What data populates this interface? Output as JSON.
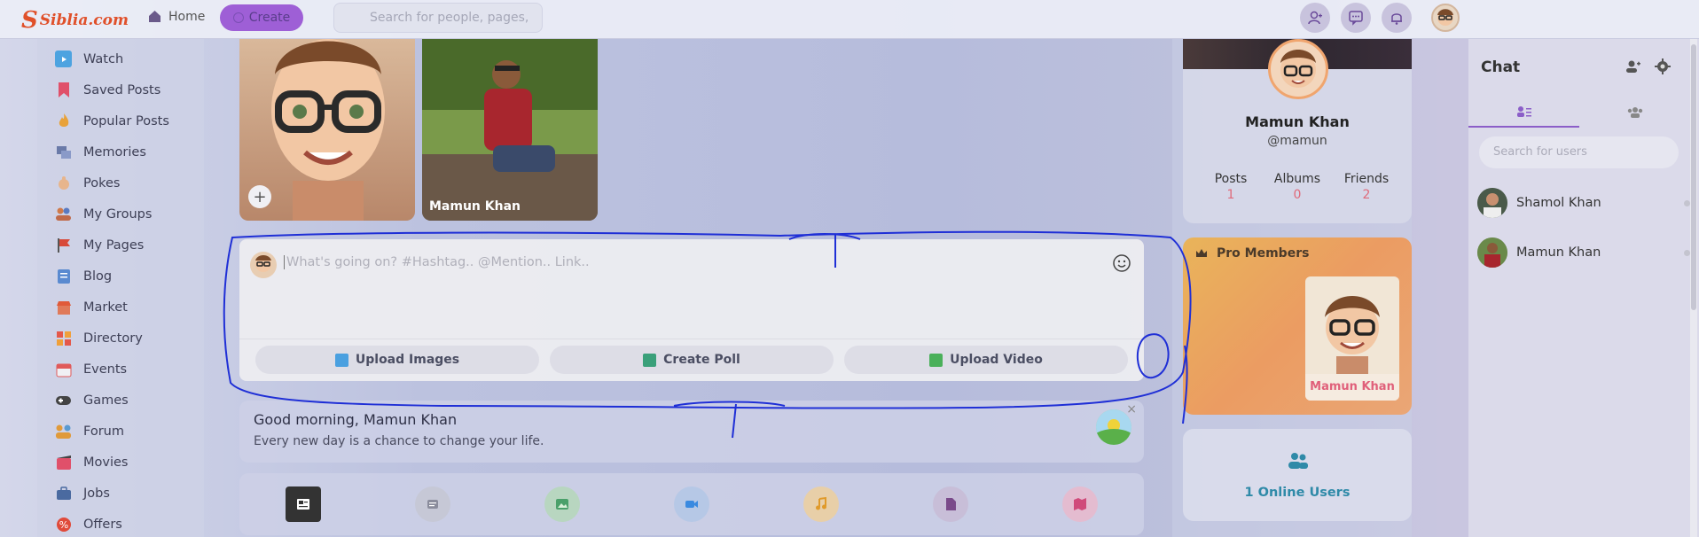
{
  "header": {
    "logo_text": "Siblia.com",
    "home_label": "Home",
    "create_label": "Create",
    "search_placeholder": "Search for people, pages,"
  },
  "sidebar": {
    "items": [
      {
        "label": "Watch",
        "icon": "watch-icon",
        "color": "#4da3e0"
      },
      {
        "label": "Saved Posts",
        "icon": "bookmark-icon",
        "color": "#e0506a"
      },
      {
        "label": "Popular Posts",
        "icon": "fire-icon",
        "color": "#e8a23a"
      },
      {
        "label": "Memories",
        "icon": "memories-icon",
        "color": "#6a7aa8"
      },
      {
        "label": "Pokes",
        "icon": "poke-icon",
        "color": "#e7b58c"
      },
      {
        "label": "My Groups",
        "icon": "groups-icon",
        "color": "#d07a4a"
      },
      {
        "label": "My Pages",
        "icon": "flag-icon",
        "color": "#d84a3a"
      },
      {
        "label": "Blog",
        "icon": "blog-icon",
        "color": "#5a8ad0"
      },
      {
        "label": "Market",
        "icon": "market-icon",
        "color": "#e05a3a"
      },
      {
        "label": "Directory",
        "icon": "directory-icon",
        "color": "#e4584a"
      },
      {
        "label": "Events",
        "icon": "events-icon",
        "color": "#e05a5a"
      },
      {
        "label": "Games",
        "icon": "gamepad-icon",
        "color": "#444"
      },
      {
        "label": "Forum",
        "icon": "forum-icon",
        "color": "#e09a3a"
      },
      {
        "label": "Movies",
        "icon": "movies-icon",
        "color": "#e0506a"
      },
      {
        "label": "Jobs",
        "icon": "jobs-icon",
        "color": "#4a6aa0"
      },
      {
        "label": "Offers",
        "icon": "offers-icon",
        "color": "#e04a3a"
      }
    ]
  },
  "stories": [
    {
      "label": "",
      "type": "create"
    },
    {
      "label": "Mamun Khan",
      "type": "story"
    }
  ],
  "composer": {
    "placeholder": "What's going on? #Hashtag.. @Mention.. Link..",
    "buttons": [
      "Upload Images",
      "Create Poll",
      "Upload Video"
    ]
  },
  "greeting": {
    "title": "Good morning, Mamun Khan",
    "subtitle": "Every new day is a chance to change your life.",
    "close": "×"
  },
  "feed_tabs": [
    "news-feed-icon",
    "posts-icon",
    "photos-icon",
    "videos-icon",
    "music-icon",
    "files-icon",
    "maps-icon"
  ],
  "profile": {
    "name": "Mamun Khan",
    "handle": "@mamun",
    "stats": [
      {
        "label": "Posts",
        "value": "1"
      },
      {
        "label": "Albums",
        "value": "0"
      },
      {
        "label": "Friends",
        "value": "2"
      }
    ]
  },
  "pro_members": {
    "title": "Pro Members",
    "member_name": "Mamun Khan"
  },
  "online": {
    "text": "1 Online Users"
  },
  "chat": {
    "title": "Chat",
    "search_placeholder": "Search for users",
    "users": [
      "Shamol Khan",
      "Mamun Khan"
    ]
  }
}
